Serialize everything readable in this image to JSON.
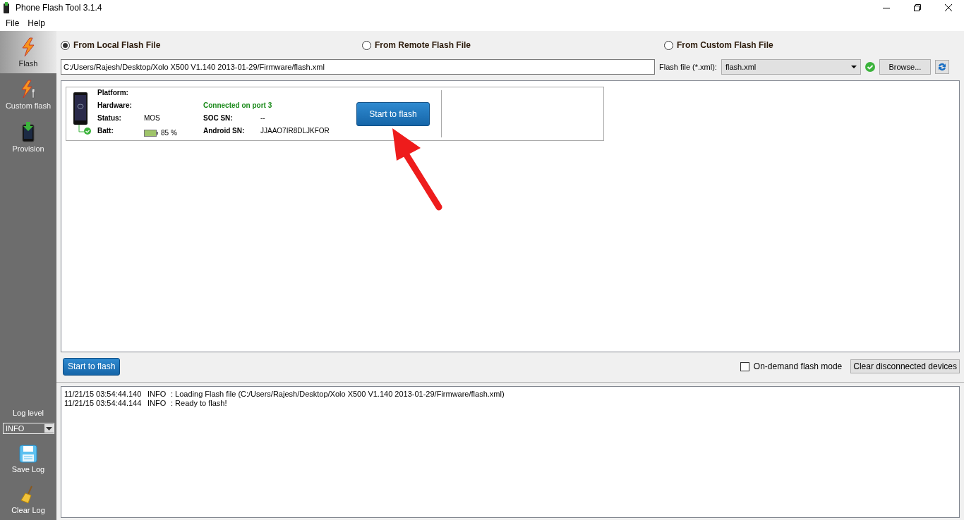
{
  "window": {
    "title": "Phone Flash Tool 3.1.4"
  },
  "menu": [
    "File",
    "Help"
  ],
  "sidebar": {
    "items": [
      {
        "label": "Flash",
        "kind": "flash",
        "selected": true
      },
      {
        "label": "Custom flash",
        "kind": "custom",
        "selected": false
      },
      {
        "label": "Provision",
        "kind": "provision",
        "selected": false
      }
    ],
    "log_level": {
      "label": "Log level",
      "value": "INFO"
    },
    "actions": [
      {
        "label": "Save Log",
        "kind": "save"
      },
      {
        "label": "Clear Log",
        "kind": "clear"
      }
    ]
  },
  "sources": [
    {
      "label": "From Local Flash File",
      "selected": true
    },
    {
      "label": "From Remote Flash File",
      "selected": false
    },
    {
      "label": "From Custom Flash File",
      "selected": false
    }
  ],
  "flash_path": "C:/Users/Rajesh/Desktop/Xolo X500 V1.140 2013-01-29/Firmware/flash.xml",
  "flash_file": {
    "label": "Flash file (*.xml):",
    "value": "flash.xml",
    "browse": "Browse..."
  },
  "device": {
    "platform_label": "Platform:",
    "hardware_label": "Hardware:",
    "status_label": "Status:",
    "status": "MOS",
    "batt_label": "Batt:",
    "batt": "85 %",
    "connection": "Connected on port 3",
    "soc_label": "SOC SN:",
    "soc": "--",
    "android_label": "Android SN:",
    "android": "JJAAO7IR8DLJKFOR",
    "button": "Start to flash"
  },
  "bottom": {
    "button": "Start to flash",
    "on_demand": {
      "label": "On-demand flash mode",
      "checked": false
    },
    "clear": "Clear disconnected devices"
  },
  "log": [
    {
      "time": "11/21/15 03:54:44.140",
      "level": "INFO",
      "message": ": Loading Flash file (C:/Users/Rajesh/Desktop/Xolo X500 V1.140 2013-01-29/Firmware/flash.xml)"
    },
    {
      "time": "11/21/15 03:54:44.144",
      "level": "INFO",
      "message": ": Ready to flash!"
    }
  ]
}
